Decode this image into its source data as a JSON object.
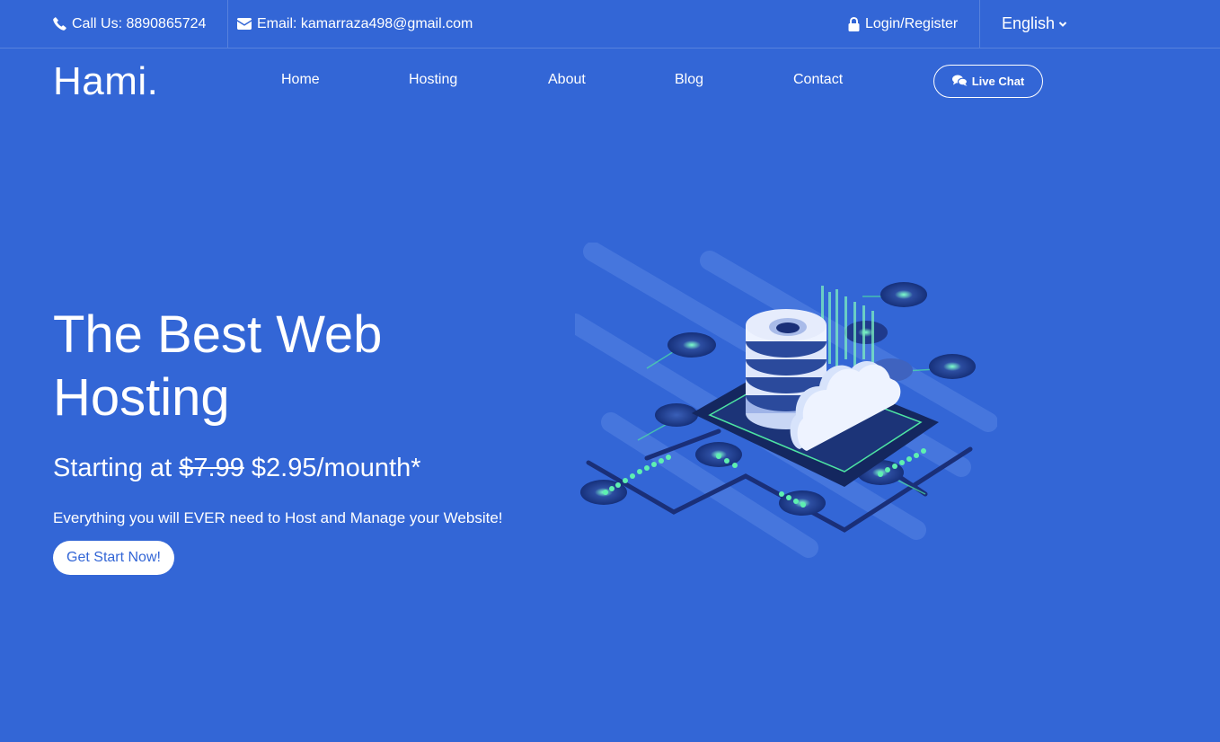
{
  "topbar": {
    "call": "Call Us: 8890865724",
    "email": "Email: kamarraza498@gmail.com",
    "login": "Login/Register",
    "language": "English"
  },
  "brand": {
    "logo": "Hami."
  },
  "nav": {
    "items": [
      "Home",
      "Hosting",
      "About",
      "Blog",
      "Contact"
    ],
    "live_chat": "Live Chat"
  },
  "hero": {
    "title": "The Best Web Hosting",
    "price_prefix": "Starting at",
    "old_price": "$7.99",
    "new_price": "$2.95/mounth*",
    "subtitle": "Everything you will EVER need to Host and Manage your Website!",
    "cta": "Get Start Now!"
  },
  "colors": {
    "background": "#3366d6",
    "text": "#ffffff",
    "accent_glow": "#4de3a3"
  },
  "icons": [
    "phone-icon",
    "envelope-icon",
    "lock-icon",
    "chevron-down-icon",
    "chat-icon",
    "server-cloud-illustration"
  ]
}
